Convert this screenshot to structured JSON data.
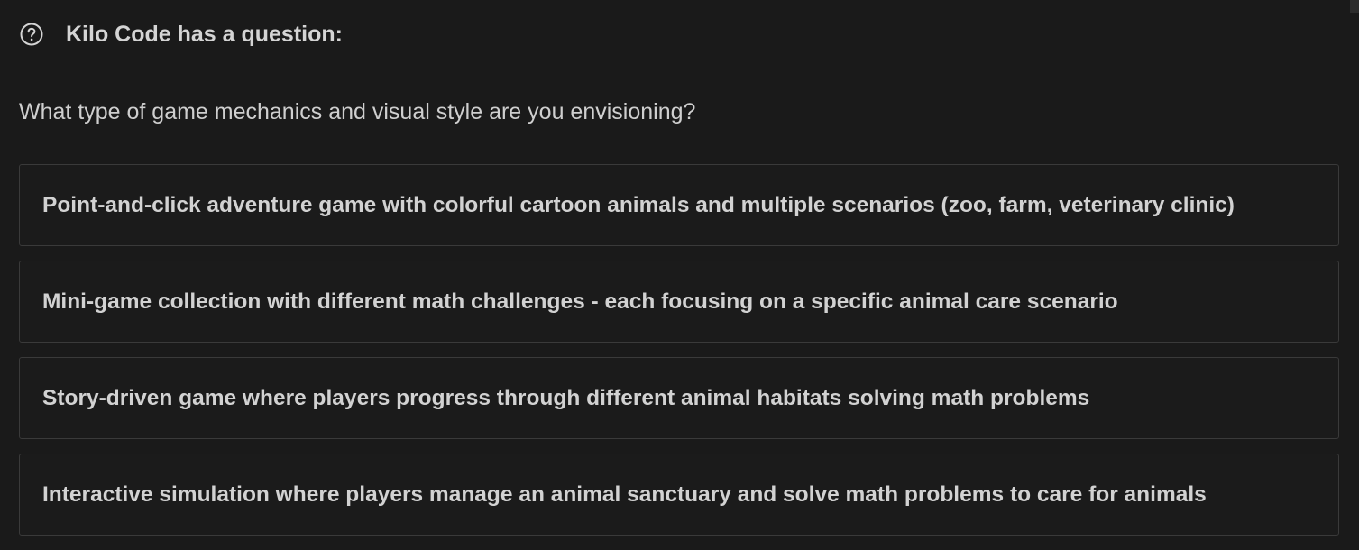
{
  "header": {
    "icon": "question-circle-icon",
    "title": "Kilo Code has a question:"
  },
  "question": "What type of game mechanics and visual style are you envisioning?",
  "options": [
    "Point-and-click adventure game with colorful cartoon animals and multiple scenarios (zoo, farm, veterinary clinic)",
    "Mini-game collection with different math challenges - each focusing on a specific animal care scenario",
    "Story-driven game where players progress through different animal habitats solving math problems",
    "Interactive simulation where players manage an animal sanctuary and solve math problems to care for animals"
  ],
  "colors": {
    "background": "#1a1a1a",
    "option_border": "#3a3a3a",
    "text": "#cccccc"
  }
}
